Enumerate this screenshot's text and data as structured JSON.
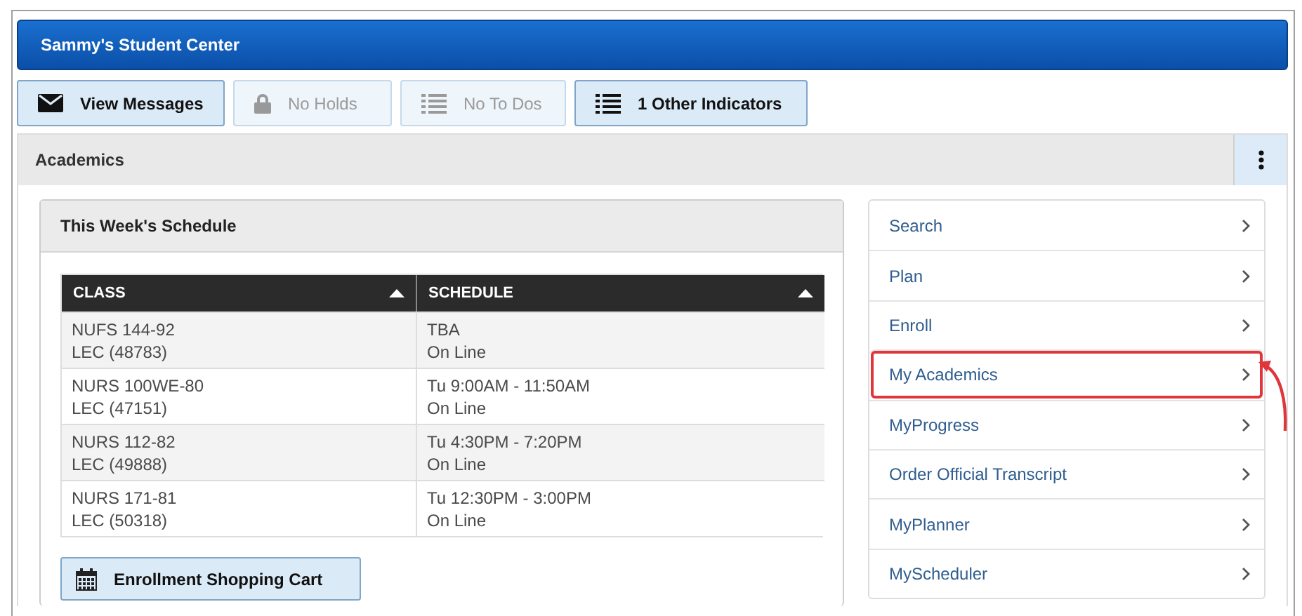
{
  "header": {
    "title": "Sammy's Student Center"
  },
  "indicators": [
    {
      "label": "View Messages",
      "disabled": false
    },
    {
      "label": "No Holds",
      "disabled": true
    },
    {
      "label": "No To Dos",
      "disabled": true
    },
    {
      "label": "1 Other Indicators",
      "disabled": false
    }
  ],
  "academics": {
    "title": "Academics",
    "schedule": {
      "title": "This Week's Schedule",
      "columns": [
        "CLASS",
        "SCHEDULE"
      ],
      "rows": [
        {
          "class": [
            "NUFS 144-92",
            "LEC (48783)"
          ],
          "schedule": [
            "TBA",
            "On Line"
          ]
        },
        {
          "class": [
            "NURS 100WE-80",
            "LEC (47151)"
          ],
          "schedule": [
            "Tu 9:00AM - 11:50AM",
            "On Line"
          ]
        },
        {
          "class": [
            "NURS 112-82",
            "LEC (49888)"
          ],
          "schedule": [
            "Tu 4:30PM - 7:20PM",
            "On Line"
          ]
        },
        {
          "class": [
            "NURS 171-81",
            "LEC (50318)"
          ],
          "schedule": [
            "Tu 12:30PM - 3:00PM",
            "On Line"
          ]
        }
      ],
      "cart_button": "Enrollment Shopping Cart"
    },
    "menu": [
      {
        "label": "Search",
        "highlighted": false
      },
      {
        "label": "Plan",
        "highlighted": false
      },
      {
        "label": "Enroll",
        "highlighted": false
      },
      {
        "label": "My Academics",
        "highlighted": true
      },
      {
        "label": "MyProgress",
        "highlighted": false
      },
      {
        "label": "Order Official Transcript",
        "highlighted": false
      },
      {
        "label": "MyPlanner",
        "highlighted": false
      },
      {
        "label": "MyScheduler",
        "highlighted": false
      }
    ]
  }
}
